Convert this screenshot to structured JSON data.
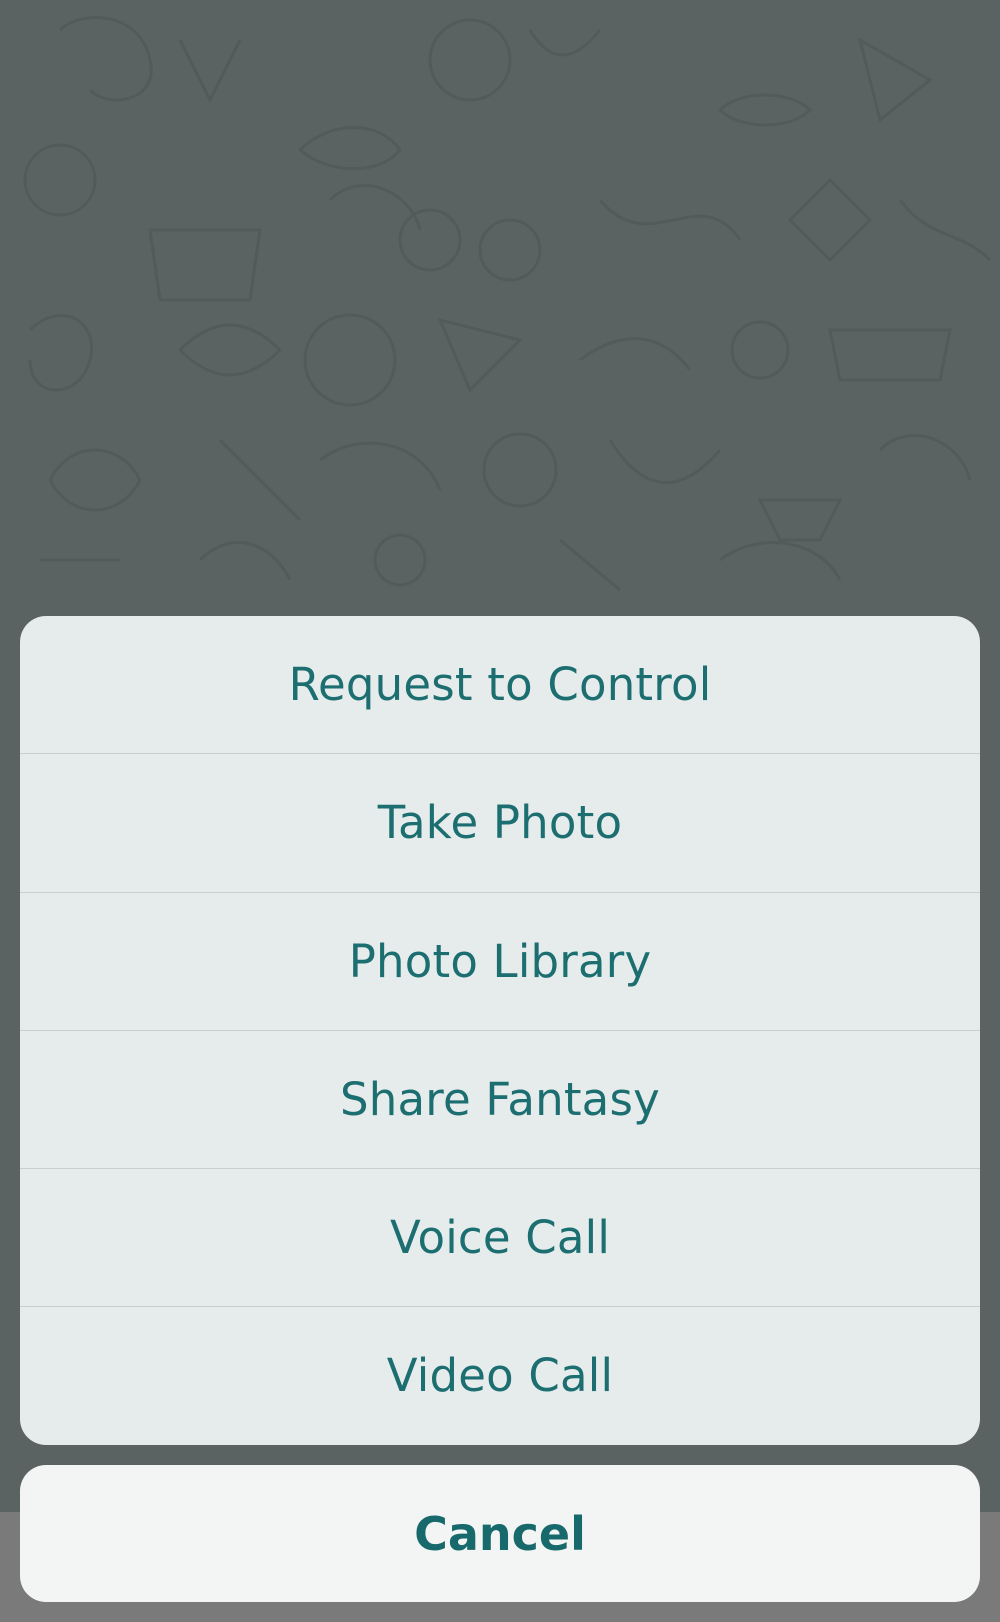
{
  "action_sheet": {
    "items": [
      {
        "label": "Request to Control"
      },
      {
        "label": "Take Photo"
      },
      {
        "label": "Photo Library"
      },
      {
        "label": "Share Fantasy"
      },
      {
        "label": "Voice Call"
      },
      {
        "label": "Video Call"
      }
    ],
    "cancel_label": "Cancel"
  },
  "colors": {
    "overlay": "#5a6362",
    "sheet_background": "#e6ecec",
    "cancel_background": "#f3f4f4",
    "action_text": "#1c6e70"
  }
}
